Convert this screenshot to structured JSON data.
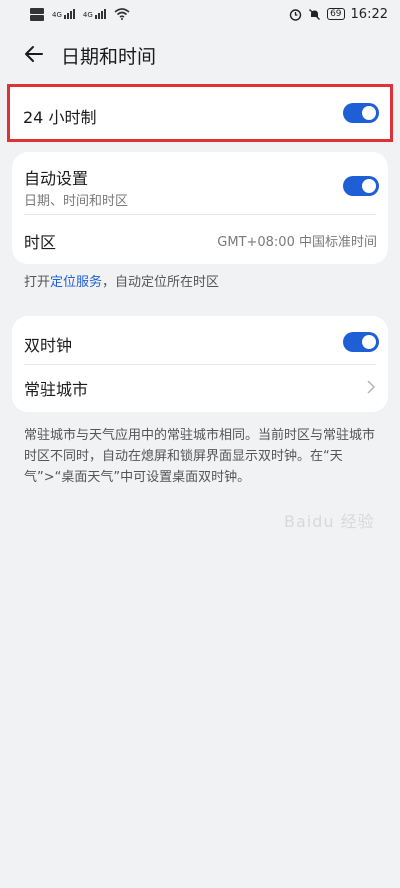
{
  "status_bar": {
    "sim1_label": "4G",
    "sim2_label": "4G",
    "battery": "69",
    "time": "16:22",
    "icons": [
      "sim-card-icon",
      "signal-icon",
      "wifi-icon",
      "alarm-icon",
      "mute-icon",
      "battery-icon"
    ]
  },
  "header": {
    "title": "日期和时间",
    "back_icon": "back-arrow-icon"
  },
  "highlight_row": {
    "label": "24 小时制",
    "toggle_on": true,
    "frame_color": "#e03137"
  },
  "auto_card": {
    "auto_label": "自动设置",
    "auto_sub": "日期、时间和时区",
    "auto_toggle_on": true,
    "timezone_label": "时区",
    "timezone_value": "GMT+08:00 中国标准时间"
  },
  "location_hint": {
    "prefix": "打开",
    "link": "定位服务",
    "suffix": "，自动定位所在时区"
  },
  "dual_card": {
    "dual_label": "双时钟",
    "dual_toggle_on": true,
    "home_city_label": "常驻城市"
  },
  "dual_hint": "常驻城市与天气应用中的常驻城市相同。当前时区与常驻城市时区不同时，自动在熄屏和锁屏界面显示双时钟。在“天气”>“桌面天气”中可设置桌面双时钟。",
  "accent_color": "#1f5fd6",
  "watermark": "Baidu 经验"
}
